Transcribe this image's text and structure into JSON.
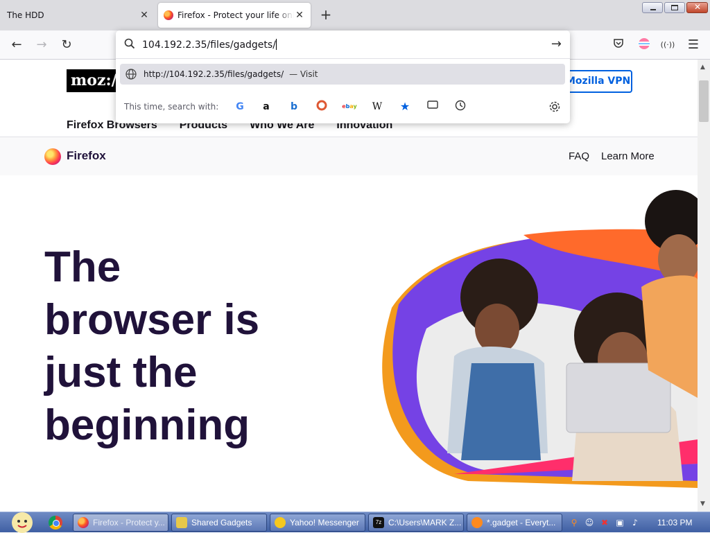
{
  "tabs": [
    {
      "title": "The HDD",
      "close": "✕"
    },
    {
      "title": "Firefox - Protect your life online",
      "close": "✕"
    }
  ],
  "new_tab": "+",
  "nav": {
    "back": "←",
    "forward": "→",
    "reload": "↻"
  },
  "toolbar_icons": {
    "pocket": "pocket-icon",
    "account": "account-icon",
    "extensions": "((·))",
    "menu": "☰"
  },
  "urlbar": {
    "typed": "104.192.2.35/files/gadgets/",
    "go": "→",
    "suggestion": {
      "url": "http://104.192.2.35/files/gadgets/",
      "action": "— Visit"
    },
    "search_with_label": "This time, search with:",
    "engines": [
      "Google",
      "Amazon",
      "Bing",
      "DuckDuckGo",
      "eBay",
      "Wikipedia",
      "Bookmarks",
      "Tabs",
      "History"
    ]
  },
  "page": {
    "logo": "moz://a",
    "vpn_button": "Mozilla VPN",
    "main_nav": [
      "Firefox Browsers",
      "Products",
      "Who We Are",
      "Innovation"
    ],
    "brand": "Firefox",
    "sub_nav": [
      "FAQ",
      "Learn More"
    ],
    "headline": [
      "The",
      "browser is",
      "just the",
      "beginning"
    ]
  },
  "taskbar": {
    "items": [
      {
        "label": "Firefox - Protect y...",
        "active": true
      },
      {
        "label": "Shared Gadgets",
        "active": false
      },
      {
        "label": "Yahoo! Messenger",
        "active": false
      },
      {
        "label": "C:\\Users\\MARK Z...",
        "active": false
      },
      {
        "label": "*.gadget - Everyt...",
        "active": false
      }
    ],
    "clock": "11:03 PM"
  },
  "colors": {
    "accent": "#0060df",
    "headline": "#20123a",
    "taskbar": "#4f6db0"
  }
}
